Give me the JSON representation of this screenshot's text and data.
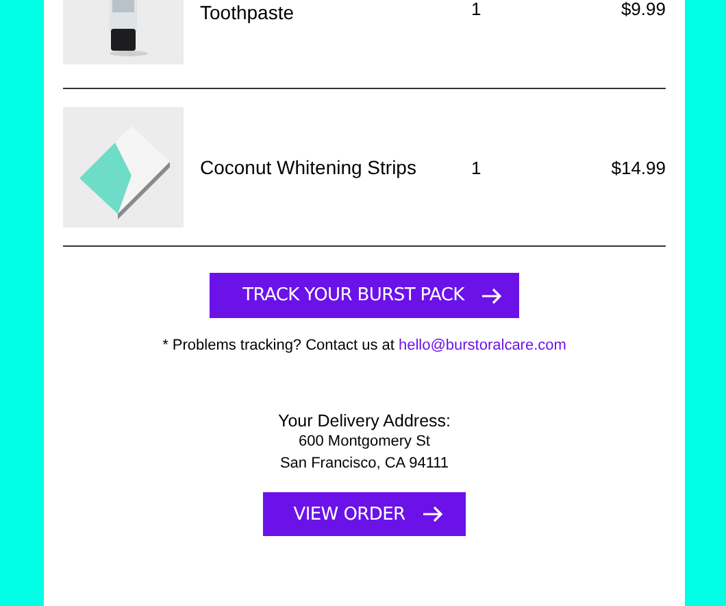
{
  "items": [
    {
      "name": "Toothpaste",
      "quantity": "1",
      "price": "$9.99",
      "kind": "tube"
    },
    {
      "name": "Coconut Whitening Strips",
      "quantity": "1",
      "price": "$14.99",
      "kind": "box"
    }
  ],
  "track_button": {
    "label": "TRACK YOUR BURST PACK"
  },
  "help_note": {
    "text": "* Problems tracking? Contact us at ",
    "link": "hello@burstoralcare.com"
  },
  "delivery": {
    "heading": "Your Delivery Address:",
    "lines": [
      "600 Montgomery St",
      "San Francisco, CA 94111"
    ]
  },
  "order_button": {
    "label": "VIEW ORDER"
  }
}
